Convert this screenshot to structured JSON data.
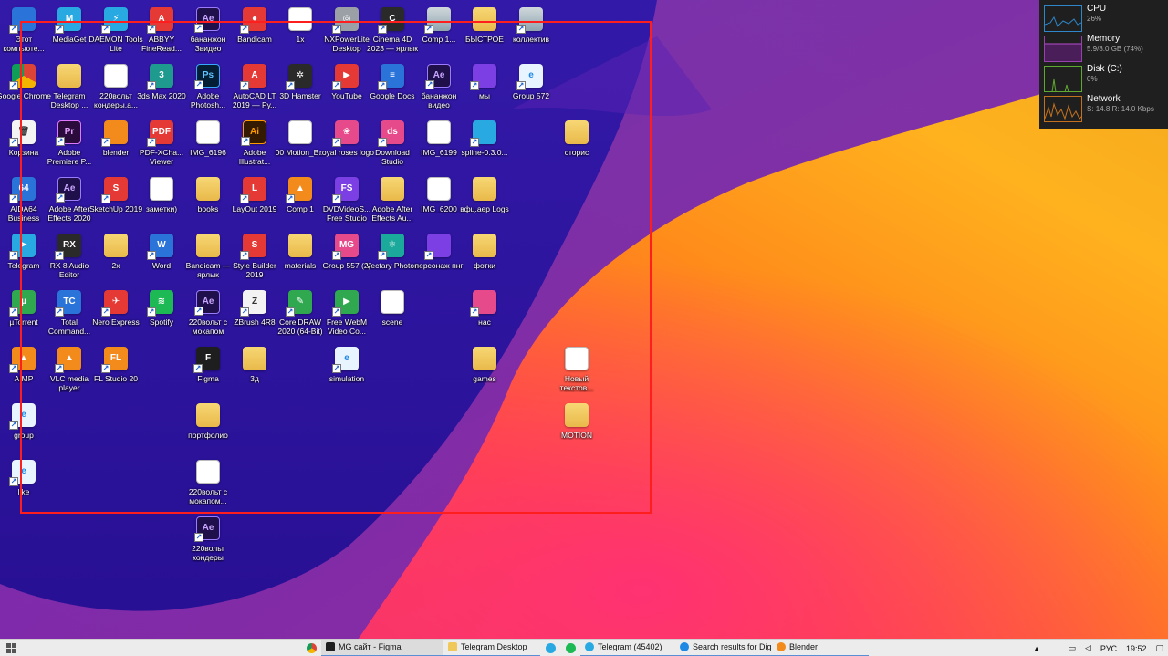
{
  "desktop": {
    "icons": [
      {
        "id": "this-pc",
        "label": "Этот компьюте...",
        "glyph": "",
        "style": "t-blue"
      },
      {
        "id": "mediaget",
        "label": "MediaGet",
        "glyph": "M",
        "style": "t-sky t-round"
      },
      {
        "id": "daemon",
        "label": "DAEMON Tools Lite",
        "glyph": "⚡",
        "style": "t-sky t-round"
      },
      {
        "id": "abbyy",
        "label": "ABBYY FineRead...",
        "glyph": "A",
        "style": "t-red"
      },
      {
        "id": "ae-banana",
        "label": "бананжон Звидео",
        "glyph": "Ae",
        "style": "t-ae"
      },
      {
        "id": "bandicam",
        "label": "Bandicam",
        "glyph": "●",
        "style": "t-red t-round"
      },
      {
        "id": "1x",
        "label": "1x",
        "glyph": "",
        "style": "t-doc"
      },
      {
        "id": "nxpower",
        "label": "NXPowerLite Desktop",
        "glyph": "◎",
        "style": "t-gray t-round"
      },
      {
        "id": "cinema4d",
        "label": "Cinema 4D 2023 — ярлык",
        "glyph": "C",
        "style": "t-dark t-round"
      },
      {
        "id": "comp1a",
        "label": "Comp 1...",
        "glyph": "",
        "style": "t-photo"
      },
      {
        "id": "bystroe",
        "label": "БЫСТРОЕ",
        "glyph": "",
        "style": "t-folder"
      },
      {
        "id": "kollektiv",
        "label": "коллектив",
        "glyph": "",
        "style": "t-photo"
      },
      {
        "id": "chrome",
        "label": "Google Chrome",
        "glyph": "",
        "style": "t-chrome"
      },
      {
        "id": "telegram-dt",
        "label": "Telegram Desktop ...",
        "glyph": "",
        "style": "t-folder"
      },
      {
        "id": "220-kondery",
        "label": "220вольт кондеры.а...",
        "glyph": "",
        "style": "t-doc"
      },
      {
        "id": "3dsmax",
        "label": "3ds Max 2020",
        "glyph": "3",
        "style": "t-3ds"
      },
      {
        "id": "photoshop",
        "label": "Adobe Photosh...",
        "glyph": "Ps",
        "style": "t-ps"
      },
      {
        "id": "autocad",
        "label": "AutoCAD LT 2019 — Ру...",
        "glyph": "A",
        "style": "t-red"
      },
      {
        "id": "3dhamster",
        "label": "3D Hamster",
        "glyph": "✲",
        "style": "t-dark"
      },
      {
        "id": "youtube",
        "label": "YouTube",
        "glyph": "▶",
        "style": "t-red"
      },
      {
        "id": "gdocs",
        "label": "Google Docs",
        "glyph": "≡",
        "style": "t-blue"
      },
      {
        "id": "ae-banana-video",
        "label": "бананжон видео",
        "glyph": "Ae",
        "style": "t-ae"
      },
      {
        "id": "my",
        "label": "мы",
        "glyph": "",
        "style": "t-purple"
      },
      {
        "id": "group572",
        "label": "Group 572",
        "glyph": "e",
        "style": "t-ie"
      },
      {
        "id": "recycle",
        "label": "Корзина",
        "glyph": "🗑",
        "style": "t-white"
      },
      {
        "id": "premiere",
        "label": "Adobe Premiere P...",
        "glyph": "Pr",
        "style": "t-pr"
      },
      {
        "id": "blender",
        "label": "blender",
        "glyph": "",
        "style": "t-orange t-round"
      },
      {
        "id": "pdfxchange",
        "label": "PDF-XCha... Viewer",
        "glyph": "PDF",
        "style": "t-red"
      },
      {
        "id": "img6196",
        "label": "IMG_6196",
        "glyph": "",
        "style": "t-doc"
      },
      {
        "id": "illustrator",
        "label": "Adobe Illustrat...",
        "glyph": "Ai",
        "style": "t-ai"
      },
      {
        "id": "motion-b",
        "label": "00 Motion_B...",
        "glyph": "",
        "style": "t-doc"
      },
      {
        "id": "royal-roses",
        "label": "royal roses logo",
        "glyph": "❀",
        "style": "t-pink t-round"
      },
      {
        "id": "download-studio",
        "label": "Download Studio",
        "glyph": "ds",
        "style": "t-pink t-round"
      },
      {
        "id": "img6199",
        "label": "IMG_6199",
        "glyph": "",
        "style": "t-doc"
      },
      {
        "id": "spline",
        "label": "spline-0.3.0...",
        "glyph": "",
        "style": "t-sky t-round"
      },
      {
        "id": "storis",
        "label": "сторис",
        "glyph": "",
        "style": "t-folder"
      },
      {
        "id": "aida64",
        "label": "AIDA64 Business",
        "glyph": "64",
        "style": "t-blue"
      },
      {
        "id": "ae2020",
        "label": "Adobe After Effects 2020",
        "glyph": "Ae",
        "style": "t-ae"
      },
      {
        "id": "sketchup",
        "label": "SketchUp 2019",
        "glyph": "S",
        "style": "t-red"
      },
      {
        "id": "zametki",
        "label": "заметки)",
        "glyph": "",
        "style": "t-doc"
      },
      {
        "id": "books",
        "label": "books",
        "glyph": "",
        "style": "t-folder"
      },
      {
        "id": "layout2019",
        "label": "LayOut 2019",
        "glyph": "L",
        "style": "t-red"
      },
      {
        "id": "comp1-vlc",
        "label": "Comp 1",
        "glyph": "▲",
        "style": "t-orange"
      },
      {
        "id": "dvdvideosoft",
        "label": "DVDVideoS... Free Studio",
        "glyph": "FS",
        "style": "t-purple"
      },
      {
        "id": "ae-au",
        "label": "Adobe After Effects Au...",
        "glyph": "",
        "style": "t-folder"
      },
      {
        "id": "img6200",
        "label": "IMG_6200",
        "glyph": "",
        "style": "t-doc"
      },
      {
        "id": "vfc-logs",
        "label": "вфц.аер Logs",
        "glyph": "",
        "style": "t-folder"
      },
      {
        "id": "telegram",
        "label": "Telegram",
        "glyph": "➤",
        "style": "t-sky t-round"
      },
      {
        "id": "rx8",
        "label": "RX 8 Audio Editor",
        "glyph": "RX",
        "style": "t-dark t-round"
      },
      {
        "id": "2x",
        "label": "2x",
        "glyph": "",
        "style": "t-folder"
      },
      {
        "id": "word",
        "label": "Word",
        "glyph": "W",
        "style": "t-blue"
      },
      {
        "id": "bandicam-link",
        "label": "Bandicam — ярлык",
        "glyph": "",
        "style": "t-folder"
      },
      {
        "id": "stylebuilder",
        "label": "Style Builder 2019",
        "glyph": "S",
        "style": "t-red"
      },
      {
        "id": "materials",
        "label": "materials",
        "glyph": "",
        "style": "t-folder"
      },
      {
        "id": "group557",
        "label": "Group 557 (2)",
        "glyph": "MG",
        "style": "t-pink"
      },
      {
        "id": "vectary",
        "label": "Vectary Photon",
        "glyph": "⚛",
        "style": "t-teal t-round"
      },
      {
        "id": "personazh",
        "label": "персонаж пнг",
        "glyph": "",
        "style": "t-purple"
      },
      {
        "id": "fotki",
        "label": "фотки",
        "glyph": "",
        "style": "t-folder"
      },
      {
        "id": "utorrent",
        "label": "µTorrent",
        "glyph": "µ",
        "style": "t-green t-round"
      },
      {
        "id": "totalcmd",
        "label": "Total Command...",
        "glyph": "TC",
        "style": "t-blue"
      },
      {
        "id": "nero",
        "label": "Nero Express",
        "glyph": "✈",
        "style": "t-red"
      },
      {
        "id": "spotify",
        "label": "Spotify",
        "glyph": "≋",
        "style": "t-spotify"
      },
      {
        "id": "220-mokap",
        "label": "220вольт с мокапом",
        "glyph": "Ae",
        "style": "t-ae"
      },
      {
        "id": "zbrush",
        "label": "ZBrush 4R8",
        "glyph": "Z",
        "style": "t-white"
      },
      {
        "id": "coreldraw",
        "label": "CorelDRAW 2020 (64-Bit)",
        "glyph": "✎",
        "style": "t-green"
      },
      {
        "id": "freewebm",
        "label": "Free WebM Video Co...",
        "glyph": "▶",
        "style": "t-green"
      },
      {
        "id": "scene",
        "label": "scene",
        "glyph": "",
        "style": "t-doc"
      },
      {
        "id": "nas",
        "label": "нас",
        "glyph": "",
        "style": "t-pink"
      },
      {
        "id": "aimp",
        "label": "AIMP",
        "glyph": "▲",
        "style": "t-orange t-round"
      },
      {
        "id": "vlc",
        "label": "VLC media player",
        "glyph": "▲",
        "style": "t-orange"
      },
      {
        "id": "flstudio",
        "label": "FL Studio 20",
        "glyph": "FL",
        "style": "t-orange"
      },
      {
        "id": "figma",
        "label": "Figma",
        "glyph": "F",
        "style": "t-figma"
      },
      {
        "id": "3d",
        "label": "3д",
        "glyph": "",
        "style": "t-folder"
      },
      {
        "id": "simulation",
        "label": "simulation",
        "glyph": "e",
        "style": "t-ie"
      },
      {
        "id": "games",
        "label": "games",
        "glyph": "",
        "style": "t-folder"
      },
      {
        "id": "new-text",
        "label": "Новый текстов...",
        "glyph": "",
        "style": "t-doc"
      },
      {
        "id": "group",
        "label": "group",
        "glyph": "e",
        "style": "t-ie"
      },
      {
        "id": "portfolio",
        "label": "портфолио",
        "glyph": "",
        "style": "t-folder"
      },
      {
        "id": "motion",
        "label": "MOTION",
        "glyph": "",
        "style": "t-folder"
      },
      {
        "id": "like",
        "label": "like",
        "glyph": "e",
        "style": "t-ie"
      },
      {
        "id": "220-mokap2",
        "label": "220вольт с мокапом...",
        "glyph": "",
        "style": "t-doc"
      },
      {
        "id": "220-kondery2",
        "label": "220вольт кондеры",
        "glyph": "Ae",
        "style": "t-ae"
      }
    ]
  },
  "monitor": {
    "cpu": {
      "title": "CPU",
      "value": "26%",
      "color": "#2f86c8"
    },
    "memory": {
      "title": "Memory",
      "value": "5.9/8.0 GB (74%)",
      "color": "#9a3fb0"
    },
    "disk": {
      "title": "Disk (C:)",
      "value": "0%",
      "color": "#5fa832"
    },
    "network": {
      "title": "Network",
      "value": "S: 14.8  R: 14.0 Kbps",
      "color": "#c2721f"
    }
  },
  "taskbar": {
    "apps": [
      {
        "label": "MG сайт - Figma",
        "color": "#1e1e1e"
      },
      {
        "label": "Telegram Desktop",
        "color": "#f0c85a"
      },
      {
        "label": "Telegram (45402)",
        "color": "#29a9e1"
      },
      {
        "label": "Search results for Dig...",
        "color": "#1e88e5"
      },
      {
        "label": "Blender",
        "color": "#f28a1c"
      }
    ],
    "language": "РУС",
    "time": "19:52"
  }
}
